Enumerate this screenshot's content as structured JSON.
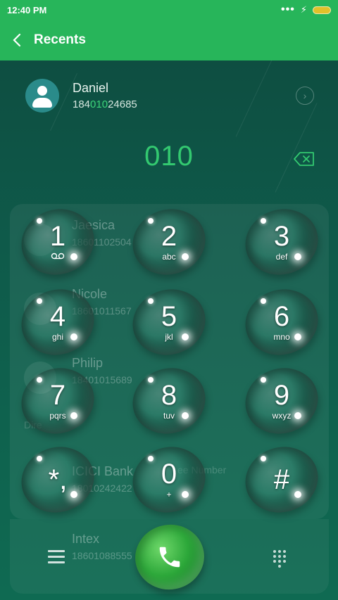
{
  "status_bar": {
    "time": "12:40 PM",
    "icons": [
      "more-dots-icon",
      "charging-bolt-icon",
      "battery-icon"
    ]
  },
  "header": {
    "title": "Recents",
    "back_icon": "chevron-left-icon"
  },
  "match": {
    "name": "Daniel",
    "number_prefix": "184",
    "number_highlight": "010",
    "number_suffix": "24685"
  },
  "dialed_number": "010",
  "background_list": [
    {
      "name": "Jaesica",
      "number": "18601102504"
    },
    {
      "name": "Nicole",
      "number": "18601011567"
    },
    {
      "name": "Philip",
      "number": "18401015689",
      "extra": "Dire"
    },
    {
      "name": "ICICI Bank",
      "number": "18010242422",
      "extra": "ee Number"
    },
    {
      "name": "Intex",
      "number": "18601088555"
    }
  ],
  "keypad": [
    {
      "digit": "1",
      "letters": "••",
      "voicemail": true
    },
    {
      "digit": "2",
      "letters": "abc"
    },
    {
      "digit": "3",
      "letters": "def"
    },
    {
      "digit": "4",
      "letters": "ghi"
    },
    {
      "digit": "5",
      "letters": "jkl"
    },
    {
      "digit": "6",
      "letters": "mno"
    },
    {
      "digit": "7",
      "letters": "pqrs"
    },
    {
      "digit": "8",
      "letters": "tuv"
    },
    {
      "digit": "9",
      "letters": "wxyz"
    },
    {
      "digit": "*,",
      "letters": ""
    },
    {
      "digit": "0",
      "letters": "+"
    },
    {
      "digit": "#",
      "letters": ""
    }
  ],
  "bottom_bar": {
    "left_icon": "menu-icon",
    "center_icon": "phone-icon",
    "right_icon": "dialpad-icon"
  },
  "colors": {
    "accent": "#27b55a",
    "highlight": "#33c970",
    "background": "#0f5a4a"
  }
}
